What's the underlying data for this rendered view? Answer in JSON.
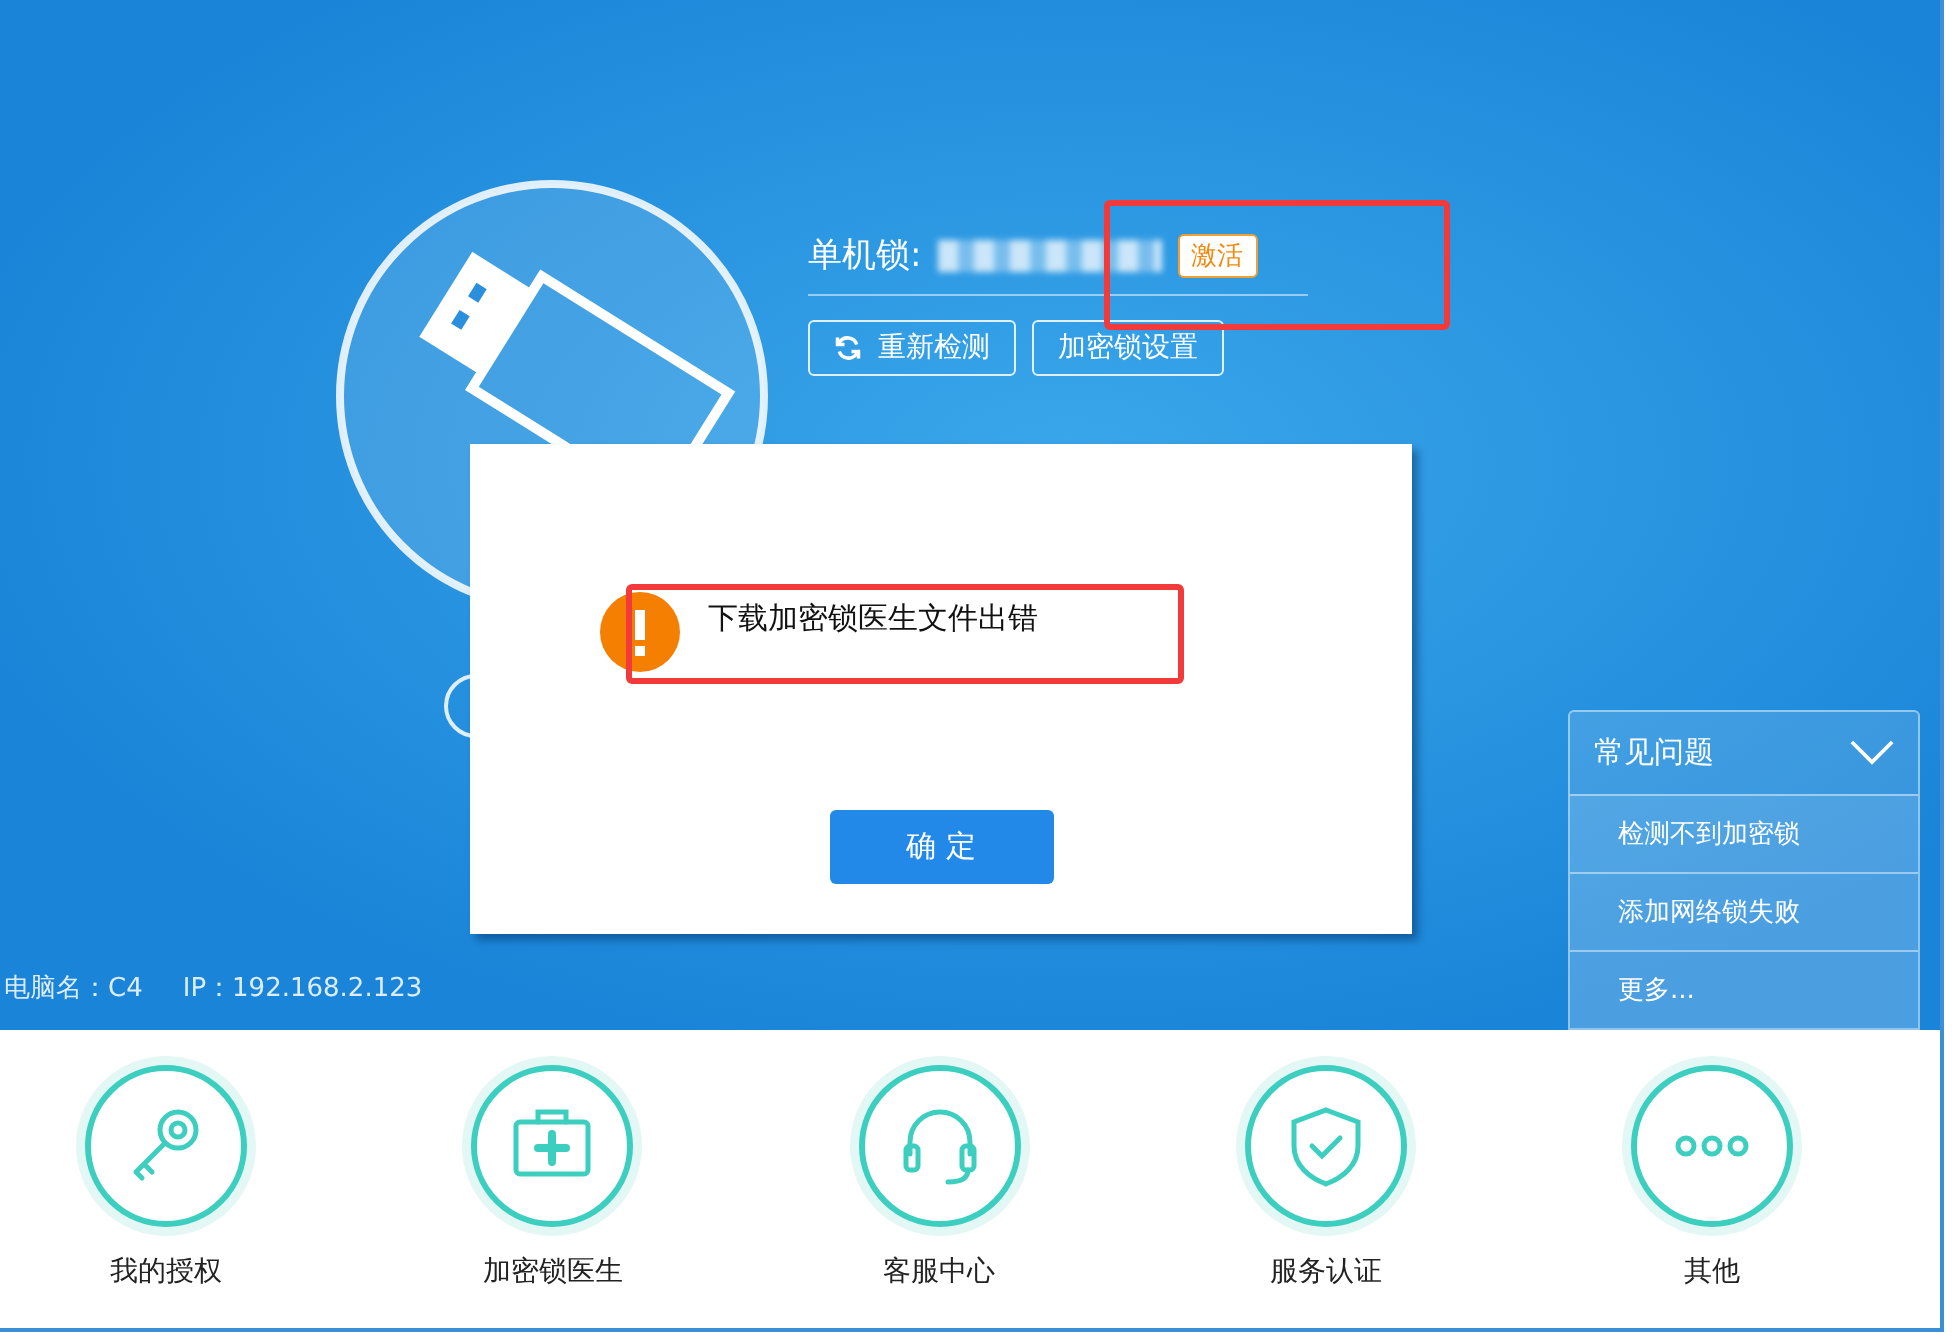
{
  "lock_info": {
    "label": "单机锁:",
    "serial_redacted": true,
    "activate_badge": "激活"
  },
  "actions": [
    {
      "kind": "refresh",
      "label": "重新检测"
    },
    {
      "kind": "plain",
      "label": "加密锁设置"
    }
  ],
  "computer_info": {
    "name": "电脑名：C4",
    "ip": "IP：192.168.2.123"
  },
  "faq": {
    "title": "常见问题",
    "expanded": true,
    "items": [
      "检测不到加密锁",
      "添加网络锁失败",
      "更多..."
    ]
  },
  "dialog": {
    "message": "下载加密锁医生文件出错",
    "button": "确 定"
  },
  "annotations": [
    {
      "kind": "highlight"
    },
    {
      "kind": "highlight"
    }
  ],
  "bottom_nav": [
    {
      "kind": "key",
      "label": "我的授权"
    },
    {
      "kind": "medkit",
      "label": "加密锁医生"
    },
    {
      "kind": "headset",
      "label": "客服中心"
    },
    {
      "kind": "shield",
      "label": "服务认证"
    },
    {
      "kind": "more",
      "label": "其他"
    }
  ]
}
